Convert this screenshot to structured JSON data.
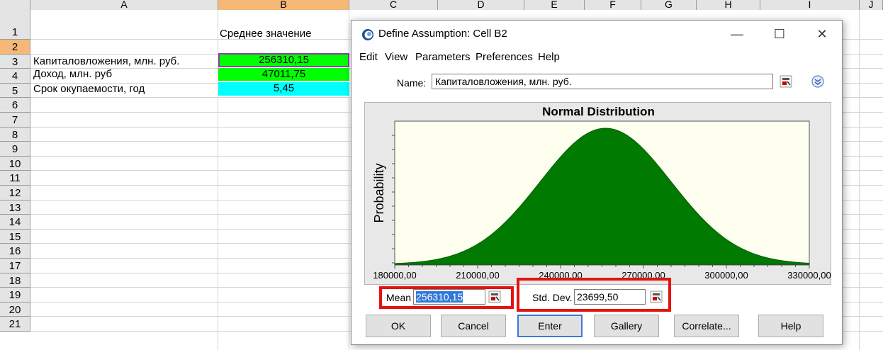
{
  "spreadsheet": {
    "columns": [
      "A",
      "B",
      "C",
      "D",
      "E",
      "F",
      "G",
      "H",
      "I",
      "J"
    ],
    "rows": [
      "1",
      "2",
      "3",
      "4",
      "5",
      "6",
      "7",
      "8",
      "9",
      "10",
      "11",
      "12",
      "13",
      "14",
      "15",
      "16",
      "17",
      "18",
      "19",
      "20",
      "21"
    ],
    "cells": {
      "B1": "Среднее значение",
      "A2": "Капиталовложения, млн. руб.",
      "B2": "256310,15",
      "A3": "Доход, млн. руб",
      "B3": "47011,75",
      "A4": "Срок окупаемости, год",
      "B4": "5,45"
    },
    "colors": {
      "selected_header": "#f5b877",
      "green_fill": "#00ff00",
      "cyan_fill": "#00ffff",
      "selection_border": "#8b3fa8"
    }
  },
  "dialog": {
    "title": "Define Assumption: Cell B2",
    "logo_icon": "crystal-ball-logo-icon",
    "window_buttons": {
      "minimize": "—",
      "maximize": "☐",
      "close": "✕"
    },
    "menu": [
      "Edit",
      "View",
      "Parameters",
      "Preferences",
      "Help"
    ],
    "name_label": "Name:",
    "name_value": "Капиталовложения, млн. руб.",
    "chart_title": "Normal Distribution",
    "mean_label": "Mean",
    "mean_value": "256310,15",
    "std_label": "Std. Dev.",
    "std_value": "23699,50",
    "buttons": {
      "ok": "OK",
      "cancel": "Cancel",
      "enter": "Enter",
      "gallery": "Gallery",
      "correlate": "Correlate...",
      "help": "Help"
    },
    "colors": {
      "highlight_box": "#e2140f",
      "curve_fill": "#007a00",
      "plot_bg": "#fffff0",
      "default_button_border": "#3b79d9"
    }
  },
  "chart_data": {
    "type": "area",
    "title": "Normal Distribution",
    "ylabel": "Probability",
    "xlabel": "",
    "xlim": [
      180000,
      330000
    ],
    "x_ticks": [
      "180000,00",
      "210000,00",
      "240000,00",
      "270000,00",
      "300000,00",
      "330000,00"
    ],
    "mean": 256310.15,
    "std_dev": 23699.5,
    "grid": false
  }
}
